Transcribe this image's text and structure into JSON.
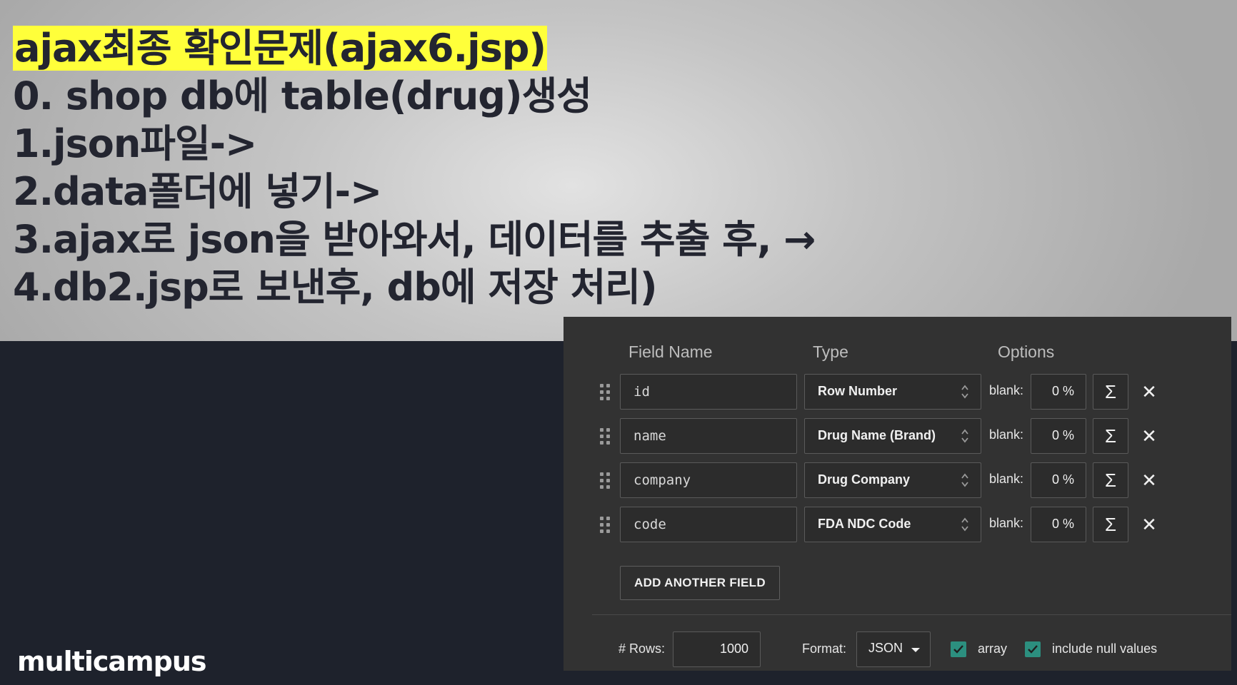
{
  "slide": {
    "lines": [
      "ajax최종 확인문제(ajax6.jsp)",
      "0. shop db에 table(drug)생성",
      "1.json파일->",
      "2.data폴더에 넣기->",
      "3.ajax로 json을 받아와서, 데이터를 추출 후, →",
      "4.db2.jsp로 보낸후, db에 저장 처리)"
    ],
    "highlight_color": "#ffff3a"
  },
  "logo": {
    "text": "multicampus"
  },
  "panel": {
    "headers": {
      "field_name": "Field Name",
      "type": "Type",
      "options": "Options"
    },
    "fields": [
      {
        "name": "id",
        "type": "Row Number",
        "blank_label": "blank:",
        "blank": "0 %"
      },
      {
        "name": "name",
        "type": "Drug Name (Brand)",
        "blank_label": "blank:",
        "blank": "0 %"
      },
      {
        "name": "company",
        "type": "Drug Company",
        "blank_label": "blank:",
        "blank": "0 %"
      },
      {
        "name": "code",
        "type": "FDA NDC Code",
        "blank_label": "blank:",
        "blank": "0 %"
      }
    ],
    "sigma_glyph": "Σ",
    "close_glyph": "✕",
    "add_button": "ADD ANOTHER FIELD",
    "footer": {
      "rows_label": "# Rows:",
      "rows_value": "1000",
      "format_label": "Format:",
      "format_value": "JSON",
      "array_label": "array",
      "array_checked": true,
      "null_label": "include null values",
      "null_checked": true
    },
    "accent_color": "#2c8f7f"
  }
}
